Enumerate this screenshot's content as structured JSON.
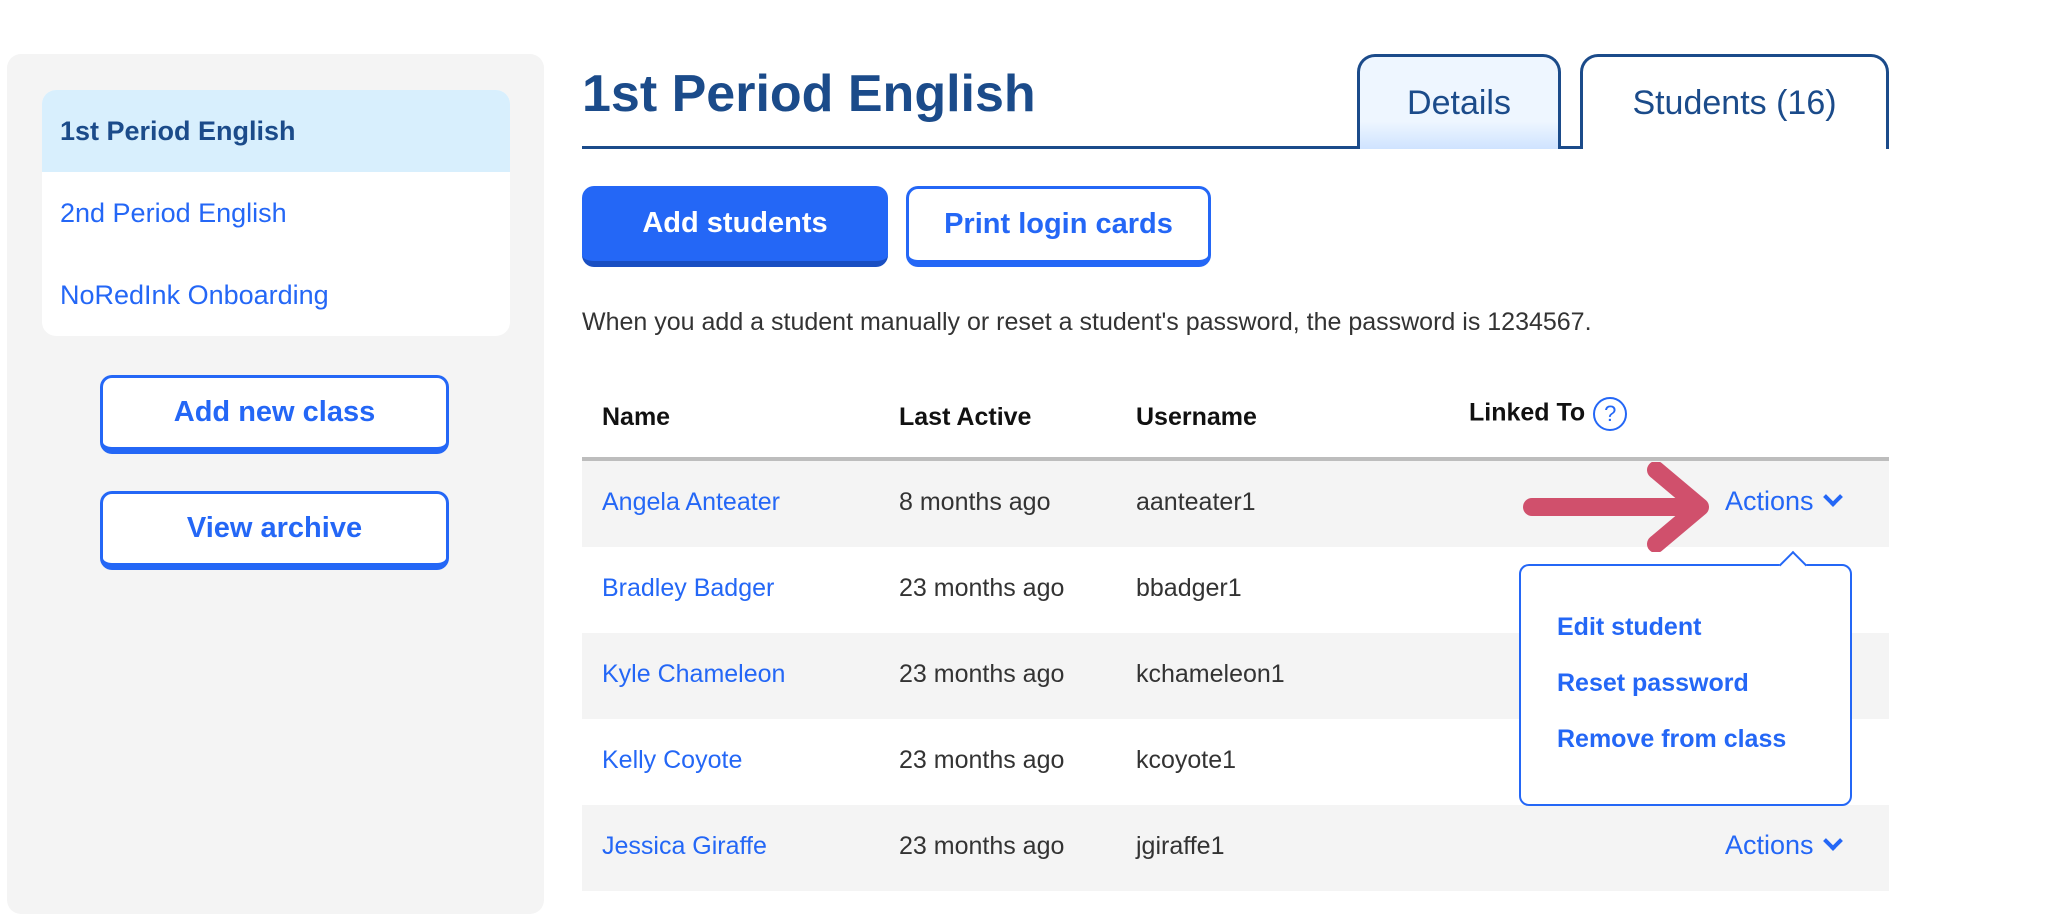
{
  "sidebar": {
    "classes": [
      {
        "label": "1st Period English",
        "selected": true
      },
      {
        "label": "2nd Period English",
        "selected": false
      },
      {
        "label": "NoRedInk Onboarding",
        "selected": false
      }
    ],
    "add_class_label": "Add new class",
    "view_archive_label": "View archive"
  },
  "header": {
    "title": "1st Period English",
    "tabs": [
      {
        "label": "Details",
        "active": false
      },
      {
        "label": "Students (16)",
        "active": true
      }
    ]
  },
  "toolbar": {
    "add_students_label": "Add students",
    "print_cards_label": "Print login cards"
  },
  "description": "When you add a student manually or reset a student's password, the password is 1234567.",
  "table": {
    "columns": [
      "Name",
      "Last Active",
      "Username",
      "Linked To"
    ],
    "rows": [
      {
        "name": "Angela Anteater",
        "last_active": "8 months ago",
        "username": "aanteater1",
        "actions": "Actions"
      },
      {
        "name": "Bradley Badger",
        "last_active": "23 months ago",
        "username": "bbadger1",
        "actions": ""
      },
      {
        "name": "Kyle Chameleon",
        "last_active": "23 months ago",
        "username": "kchameleon1",
        "actions": ""
      },
      {
        "name": "Kelly Coyote",
        "last_active": "23 months ago",
        "username": "kcoyote1",
        "actions": ""
      },
      {
        "name": "Jessica Giraffe",
        "last_active": "23 months ago",
        "username": "jgiraffe1",
        "actions": "Actions"
      }
    ]
  },
  "actions_menu": {
    "items": [
      "Edit student",
      "Reset password",
      "Remove from class"
    ]
  },
  "colors": {
    "primary": "#2467f6",
    "navy": "#1b4b8a",
    "annotation_arrow": "#d0506c"
  }
}
